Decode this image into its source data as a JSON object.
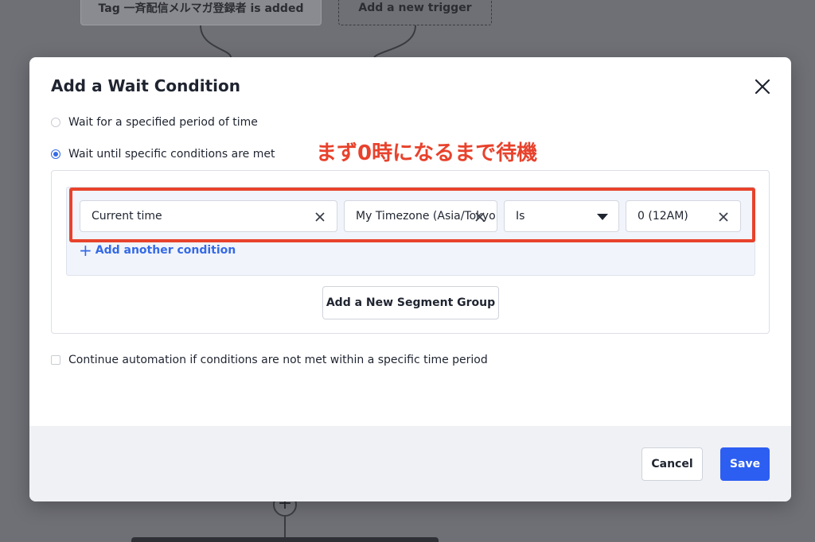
{
  "background": {
    "trigger_node_label": "Tag 一斉配信メルマガ登録者 is added",
    "add_trigger_label": "Add a new trigger",
    "plus_glyph": "+"
  },
  "modal": {
    "title": "Add a Wait Condition",
    "close_icon": "close-icon",
    "options": [
      {
        "label": "Wait for a specified period of time",
        "selected": false
      },
      {
        "label": "Wait until specific conditions are met",
        "selected": true
      }
    ],
    "annotation": "まず0時になるまで待機",
    "condition": {
      "field": "Current time",
      "timezone": "My Timezone (Asia/Tokyo)",
      "operator": "Is",
      "value": "0 (12AM)"
    },
    "add_condition_label": "Add another condition",
    "add_segment_group_label": "Add a New Segment Group",
    "continue_checkbox_label": "Continue automation if conditions are not met within a specific time period",
    "continue_checked": false,
    "footer": {
      "cancel_label": "Cancel",
      "save_label": "Save"
    }
  },
  "colors": {
    "accent": "#2c5ef2",
    "annotation": "#e8422c",
    "link": "#356ae6",
    "overlay": "#6f7076"
  }
}
